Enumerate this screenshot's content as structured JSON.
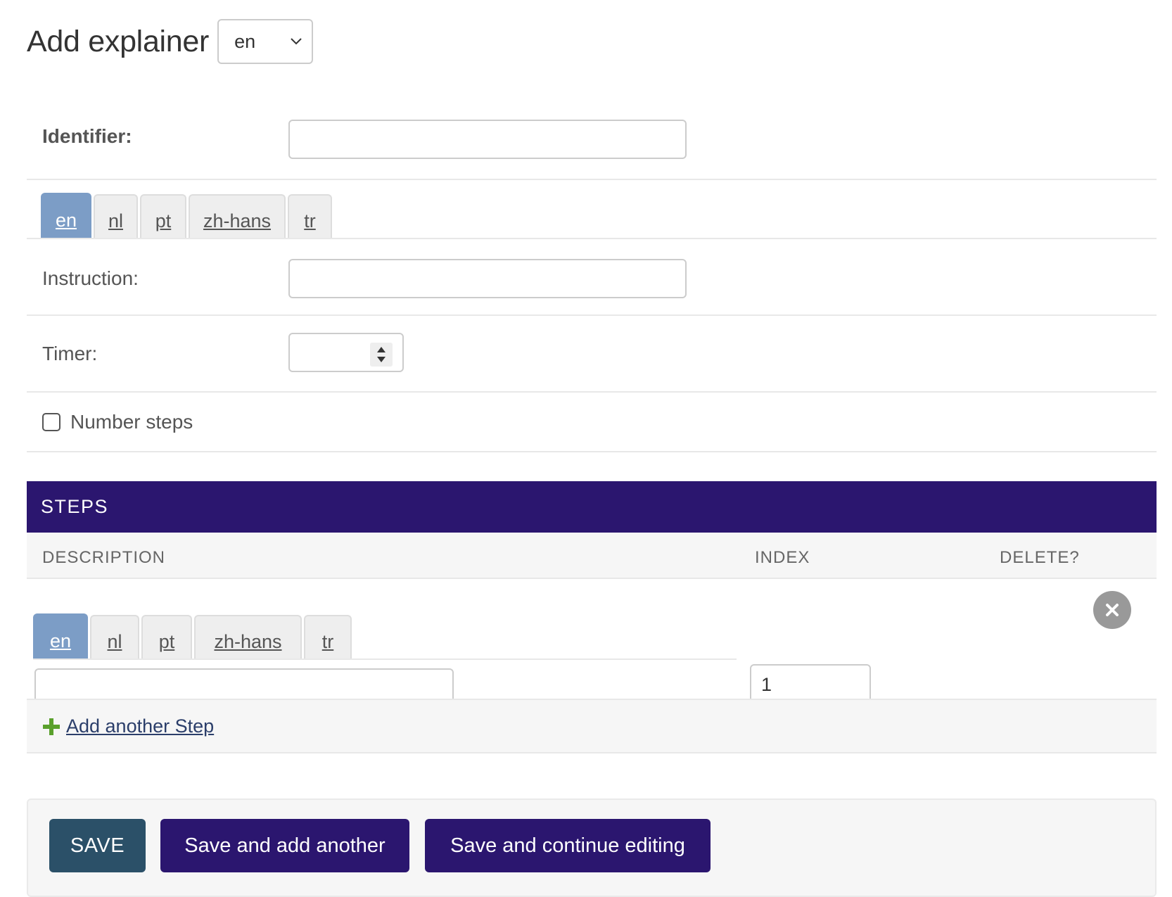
{
  "header": {
    "title": "Add explainer",
    "language_select": {
      "value": "en"
    }
  },
  "identifier": {
    "label": "Identifier:",
    "value": ""
  },
  "language_tabs": [
    "en",
    "nl",
    "pt",
    "zh-hans",
    "tr"
  ],
  "active_tab": "en",
  "instruction": {
    "label": "Instruction:",
    "value": ""
  },
  "timer": {
    "label": "Timer:",
    "value": ""
  },
  "number_steps": {
    "label": "Number steps",
    "checked": false
  },
  "steps": {
    "title": "STEPS",
    "columns": {
      "description": "DESCRIPTION",
      "index": "INDEX",
      "delete": "DELETE?"
    },
    "rows": [
      {
        "description": "",
        "index": "1"
      }
    ],
    "add_another": "Add another Step"
  },
  "buttons": {
    "save": "SAVE",
    "save_add": "Save and add another",
    "save_continue": "Save and continue editing"
  }
}
